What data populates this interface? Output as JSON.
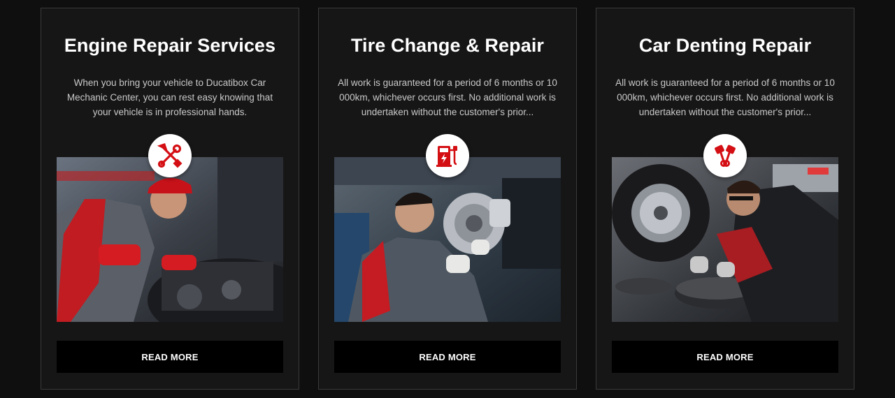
{
  "services": [
    {
      "title": "Engine Repair Services",
      "description": "When you bring your vehicle to Ducatibox Car Mechanic Center, you can rest easy knowing that your vehicle is in professional hands.",
      "icon": "wrench-screwdriver-icon",
      "button_label": "READ MORE"
    },
    {
      "title": "Tire Change & Repair",
      "description": "All work is guaranteed for a period of 6 months or 10 000km, whichever occurs first. No additional work is undertaken without the customer's prior...",
      "icon": "ev-charger-icon",
      "button_label": "READ MORE"
    },
    {
      "title": "Car Denting Repair",
      "description": "All work is guaranteed for a period of 6 months or 10 000km, whichever occurs first. No additional work is undertaken without the customer's prior...",
      "icon": "pistons-icon",
      "button_label": "READ MORE"
    }
  ],
  "colors": {
    "background": "#0f0f0f",
    "card": "#161616",
    "accent": "#d40f14",
    "button": "#000000"
  }
}
